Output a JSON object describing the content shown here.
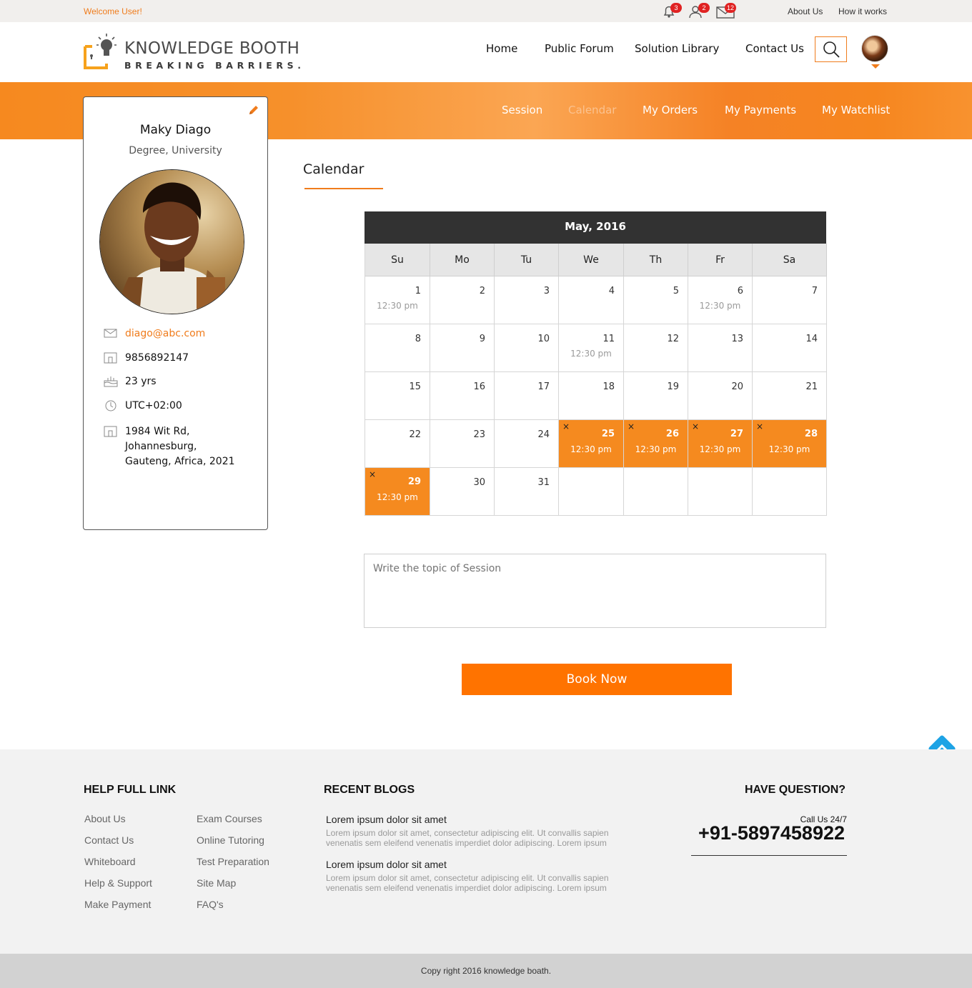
{
  "topbar": {
    "welcome": "Welcome User!",
    "notifications": {
      "alerts": "3",
      "requests": "2",
      "messages": "12"
    },
    "links": [
      "About Us",
      "How it works"
    ]
  },
  "header": {
    "logo_name": "KNOWLEDGE BOOTH",
    "logo_tagline": "BREAKING BARRIERS.",
    "nav": [
      "Home",
      "Public Forum",
      "Solution Library",
      "Contact Us"
    ]
  },
  "subnav": {
    "items": [
      "Session",
      "Calendar",
      "My Orders",
      "My Payments",
      "My Watchlist"
    ],
    "active": "Calendar"
  },
  "profile": {
    "name": "Maky Diago",
    "degree": "Degree, University",
    "email": "diago@abc.com",
    "phone": "9856892147",
    "age": "23 yrs",
    "timezone": "UTC+02:00",
    "address_lines": [
      "1984 Wit Rd,",
      "Johannesburg,",
      "Gauteng, Africa, 2021"
    ]
  },
  "calendar": {
    "title": "Calendar",
    "month": "May, 2016",
    "days": [
      "Su",
      "Mo",
      "Tu",
      "We",
      "Th",
      "Fr",
      "Sa"
    ],
    "weeks": [
      [
        {
          "d": "1",
          "t": "12:30 pm"
        },
        {
          "d": "2"
        },
        {
          "d": "3"
        },
        {
          "d": "4"
        },
        {
          "d": "5"
        },
        {
          "d": "6",
          "t": "12:30 pm"
        },
        {
          "d": "7"
        }
      ],
      [
        {
          "d": "8"
        },
        {
          "d": "9"
        },
        {
          "d": "10"
        },
        {
          "d": "11",
          "t": "12:30 pm"
        },
        {
          "d": "12"
        },
        {
          "d": "13"
        },
        {
          "d": "14"
        }
      ],
      [
        {
          "d": "15"
        },
        {
          "d": "16"
        },
        {
          "d": "17"
        },
        {
          "d": "18"
        },
        {
          "d": "19"
        },
        {
          "d": "20"
        },
        {
          "d": "21"
        }
      ],
      [
        {
          "d": "22"
        },
        {
          "d": "23"
        },
        {
          "d": "24"
        },
        {
          "d": "25",
          "t": "12:30 pm",
          "booked": true
        },
        {
          "d": "26",
          "t": "12:30 pm",
          "booked": true
        },
        {
          "d": "27",
          "t": "12:30 pm",
          "booked": true
        },
        {
          "d": "28",
          "t": "12:30 pm",
          "booked": true
        }
      ],
      [
        {
          "d": "29",
          "t": "12:30 pm",
          "booked": true
        },
        {
          "d": "30"
        },
        {
          "d": "31"
        },
        {
          "d": ""
        },
        {
          "d": ""
        },
        {
          "d": ""
        },
        {
          "d": ""
        }
      ]
    ],
    "remove_glyph": "×"
  },
  "form": {
    "topic_placeholder": "Write the topic of Session",
    "book_label": "Book Now"
  },
  "footer": {
    "help_heading": "HELP FULL LINK",
    "help_col1": [
      "About Us",
      "Contact Us",
      "Whiteboard",
      "Help & Support",
      "Make Payment"
    ],
    "help_col2": [
      "Exam Courses",
      "Online Tutoring",
      "Test Preparation",
      "Site Map",
      "FAQ's"
    ],
    "blogs_heading": "RECENT BLOGS",
    "blogs": [
      {
        "title": "Lorem ipsum dolor sit amet",
        "body": "Lorem ipsum dolor sit amet, consectetur adipiscing elit. Ut convallis sapien venenatis sem eleifend venenatis imperdiet dolor adipiscing. Lorem ipsum"
      },
      {
        "title": "Lorem ipsum dolor sit amet",
        "body": "Lorem ipsum dolor sit amet, consectetur adipiscing elit. Ut convallis sapien venenatis sem eleifend venenatis imperdiet dolor adipiscing. Lorem ipsum"
      }
    ],
    "question_heading": "HAVE QUESTION?",
    "call_label": "Call Us 24/7",
    "phone": "+91-5897458922",
    "copyright": "Copy right 2016  knowledge boath."
  },
  "colors": {
    "accent": "#f07c1c",
    "button": "#ff7300",
    "calendar_header": "#323232",
    "booked": "#f58a1f"
  }
}
